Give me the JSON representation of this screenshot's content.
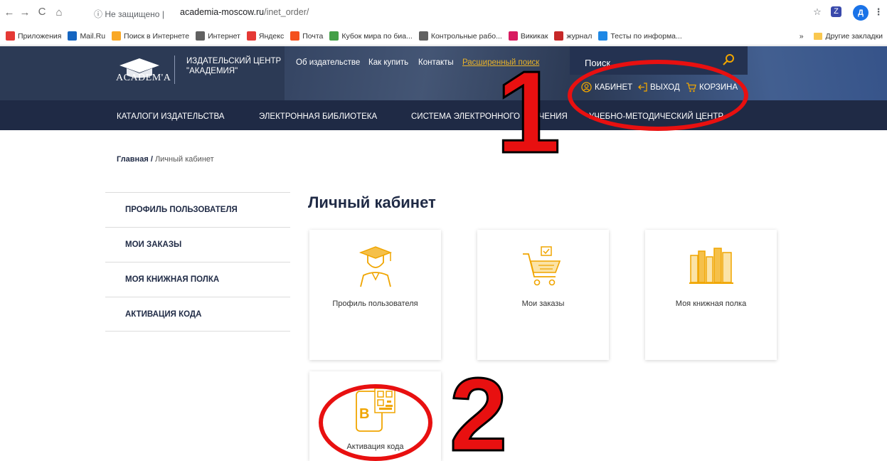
{
  "browser": {
    "security": "Не защищено",
    "host": "academia-moscow.ru",
    "path": "/inet_order/",
    "profile_letter": "Д"
  },
  "bookmarks": {
    "items": [
      {
        "label": "Приложения",
        "icon": "apps-icon",
        "color": "#e53935"
      },
      {
        "label": "Mail.Ru",
        "icon": "mailru-icon",
        "color": "#1565c0"
      },
      {
        "label": "Поиск в Интернете",
        "icon": "search-bookmark-icon",
        "color": "#f9a825"
      },
      {
        "label": "Интернет",
        "icon": "globe-icon",
        "color": "#616161"
      },
      {
        "label": "Яндекс",
        "icon": "yandex-icon",
        "color": "#e53935"
      },
      {
        "label": "Почта",
        "icon": "mail-icon",
        "color": "#f4511e"
      },
      {
        "label": "Кубок мира по биа...",
        "icon": "site-icon",
        "color": "#43a047"
      },
      {
        "label": "Контрольные рабо...",
        "icon": "globe-icon",
        "color": "#616161"
      },
      {
        "label": "Викикак",
        "icon": "wikikak-icon",
        "color": "#d81b60"
      },
      {
        "label": "журнал",
        "icon": "journal-icon",
        "color": "#c62828"
      },
      {
        "label": "Тесты по информа...",
        "icon": "check-icon",
        "color": "#1e88e5"
      }
    ],
    "other": "Другие закладки"
  },
  "site": {
    "logo": "ACADEM'A",
    "brand_line1": "ИЗДАТЕЛЬСКИЙ ЦЕНТР",
    "brand_line2": "\"АКАДЕМИЯ\"",
    "nav": [
      "Об издательстве",
      "Как купить",
      "Контакты",
      "Расширенный поиск"
    ],
    "search_label": "Поиск",
    "user_links": [
      "КАБИНЕТ",
      "ВЫХОД",
      "КОРЗИНА"
    ],
    "menu": [
      "КАТАЛОГИ ИЗДАТЕЛЬСТВА",
      "ЭЛЕКТРОННАЯ БИБЛИОТЕКА",
      "СИСТЕМА ЭЛЕКТРОННОГО ОБУЧЕНИЯ",
      "УЧЕБНО-МЕТОДИЧЕСКИЙ ЦЕНТР"
    ]
  },
  "breadcrumb": {
    "home": "Главная",
    "sep": "/",
    "current": "Личный кабинет"
  },
  "sidebar": [
    "ПРОФИЛЬ ПОЛЬЗОВАТЕЛЯ",
    "МОИ ЗАКАЗЫ",
    "МОЯ КНИЖНАЯ ПОЛКА",
    "АКТИВАЦИЯ КОДА"
  ],
  "main": {
    "title": "Личный кабинет",
    "cards": [
      {
        "label": "Профиль пользователя",
        "icon": "graduate-icon"
      },
      {
        "label": "Мои заказы",
        "icon": "cart-icon"
      },
      {
        "label": "Моя книжная полка",
        "icon": "bookshelf-icon"
      },
      {
        "label": "Активация кода",
        "icon": "qr-phone-icon"
      }
    ]
  },
  "annotations": {
    "marker_1": "1",
    "marker_2": "2"
  },
  "colors": {
    "accent": "#f0a500",
    "header": "#2c3a55",
    "menu": "#1f2a45",
    "marker": "#e81010"
  }
}
